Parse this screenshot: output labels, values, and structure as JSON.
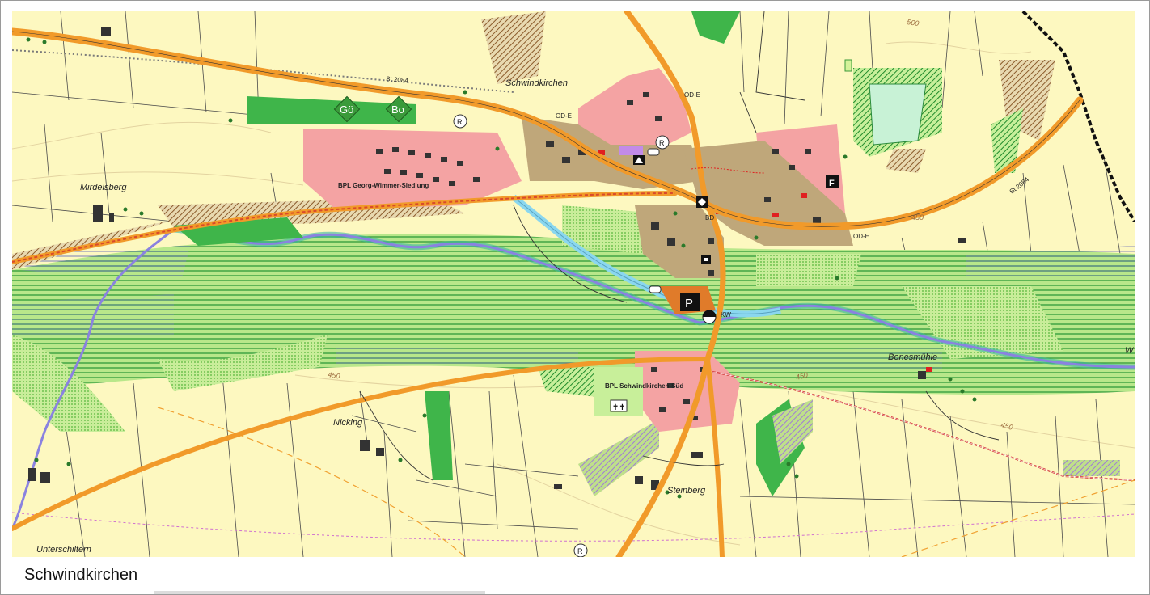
{
  "caption": "Schwindkirchen",
  "map": {
    "places": {
      "schwindkirchen": "Schwindkirchen",
      "mirdelsberg": "Mirdelsberg",
      "nicking": "Nicking",
      "steinberg": "Steinberg",
      "bonesmuehle": "Bonesmühle",
      "unterschiltern": "Unterschiltern",
      "w": "W"
    },
    "roads": {
      "st2084_left": "St 2084",
      "st2084_right": "St 2084"
    },
    "od_labels": [
      "OD-E",
      "OD-E",
      "OD-E"
    ],
    "plan_labels": {
      "bpl_north": "BPL Georg-Wimmer-Siedlung",
      "bpl_south": "BPL Schwindkirchen-Süd"
    },
    "contours": {
      "c500": "500",
      "c450a": "450",
      "c450b": "450",
      "c450c": "450",
      "c450d": "450"
    },
    "symbols": {
      "go": "Gö",
      "bo": "Bo",
      "r": "R",
      "p": "P",
      "f": "F",
      "bd": "BD",
      "kw": "KW"
    },
    "colors": {
      "background": "#fdf8c0",
      "residential": "#f4a3a3",
      "mixed_village": "#bfa77a",
      "green": "#48c43c",
      "light_green": "#a9e28a",
      "road": "#f19a2a",
      "stream": "#8aa0e6",
      "water": "#aee2f0"
    }
  }
}
